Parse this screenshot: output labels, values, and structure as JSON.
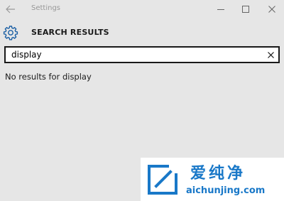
{
  "window": {
    "title": "Settings"
  },
  "header": {
    "title": "SEARCH RESULTS",
    "icon": "gear-icon"
  },
  "search": {
    "value": "display",
    "clear_icon": "close-icon"
  },
  "results": {
    "message": "No results for display"
  },
  "watermark": {
    "brand": "爱纯净",
    "url": "aichunjing.com",
    "color": "#1978c8"
  },
  "colors": {
    "background": "#e6e6e6",
    "accent": "#1b5fa4",
    "input_border": "#1a1a1a"
  }
}
